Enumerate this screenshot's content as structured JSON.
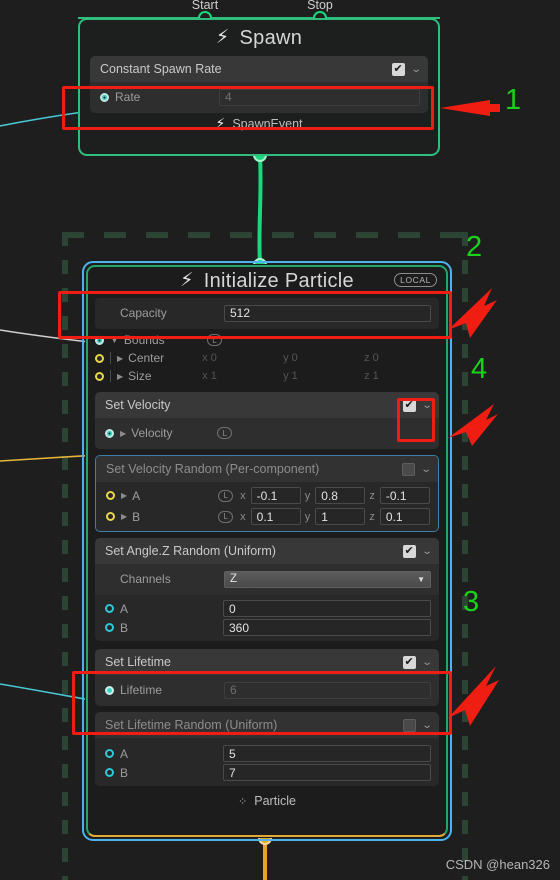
{
  "canvas": {
    "background": "#1e1e1e",
    "watermark": "CSDN @hean326"
  },
  "spawn_context": {
    "title": "Spawn",
    "icon": "lightning-bolt-icon",
    "border_color": "#2fbe7e",
    "input_ports": [
      {
        "label": "Start"
      },
      {
        "label": "Stop"
      }
    ],
    "footer": {
      "label": "SpawnEvent",
      "icon": "lightning-bolt-icon"
    },
    "blocks": [
      {
        "title": "Constant Spawn Rate",
        "enabled": true,
        "checkbox_glyph": "✔",
        "rows": [
          {
            "label": "Rate",
            "value": "4",
            "port": "filled-cy",
            "field_style": "ghost"
          }
        ]
      }
    ]
  },
  "initialize_context": {
    "title": "Initialize Particle",
    "icon": "lightning-bolt-icon",
    "space_badge": "LOCAL",
    "selection_border_color": "#4db2f0",
    "border_color": "#24a56c",
    "output_border_color": "#e0a93a",
    "footer": {
      "label": "Particle",
      "icon": "particle-icon"
    },
    "capacity": {
      "label": "Capacity",
      "value": "512"
    },
    "bounds": {
      "label": "Bounds",
      "space": "L",
      "children": [
        {
          "label": "Center",
          "x": "x 0",
          "y": "y 0",
          "z": "z 0"
        },
        {
          "label": "Size",
          "x": "x 1",
          "y": "y 1",
          "z": "z 1"
        }
      ]
    },
    "blocks": [
      {
        "title": "Set Velocity",
        "enabled": true,
        "checkbox_glyph": "✔",
        "dim": false,
        "rows": [
          {
            "label": "Velocity",
            "space": "L",
            "port": "filled-cy"
          }
        ]
      },
      {
        "title": "Set Velocity Random (Per-component)",
        "enabled": false,
        "checkbox_glyph": "",
        "dim": true,
        "vector_rows": [
          {
            "label": "A",
            "space": "L",
            "x": "-0.1",
            "y": "0.8",
            "z": "-0.1",
            "port": "ring-yellow"
          },
          {
            "label": "B",
            "space": "L",
            "x": "0.1",
            "y": "1",
            "z": "0.1",
            "port": "ring-yellow"
          }
        ]
      },
      {
        "title": "Set Angle.Z Random (Uniform)",
        "enabled": true,
        "checkbox_glyph": "✔",
        "dim": false,
        "channels": {
          "label": "Channels",
          "value": "Z"
        },
        "scalar_rows": [
          {
            "label": "A",
            "value": "0",
            "port": "ring-cyan"
          },
          {
            "label": "B",
            "value": "360",
            "port": "ring-cyan"
          }
        ]
      },
      {
        "title": "Set Lifetime",
        "enabled": true,
        "checkbox_glyph": "✔",
        "dim": false,
        "rows": [
          {
            "label": "Lifetime",
            "value": "6",
            "port": "dot-cyan",
            "field_style": "ghost"
          }
        ]
      },
      {
        "title": "Set Lifetime Random (Uniform)",
        "enabled": false,
        "checkbox_glyph": "",
        "dim": true,
        "scalar_rows": [
          {
            "label": "A",
            "value": "5",
            "port": "ring-cyan"
          },
          {
            "label": "B",
            "value": "7",
            "port": "ring-cyan"
          }
        ]
      }
    ]
  },
  "annotations": {
    "color": "#18d318",
    "highlight_color": "#f01d12",
    "numbers": [
      {
        "text": "1"
      },
      {
        "text": "2"
      },
      {
        "text": "4"
      },
      {
        "text": "3"
      }
    ]
  }
}
